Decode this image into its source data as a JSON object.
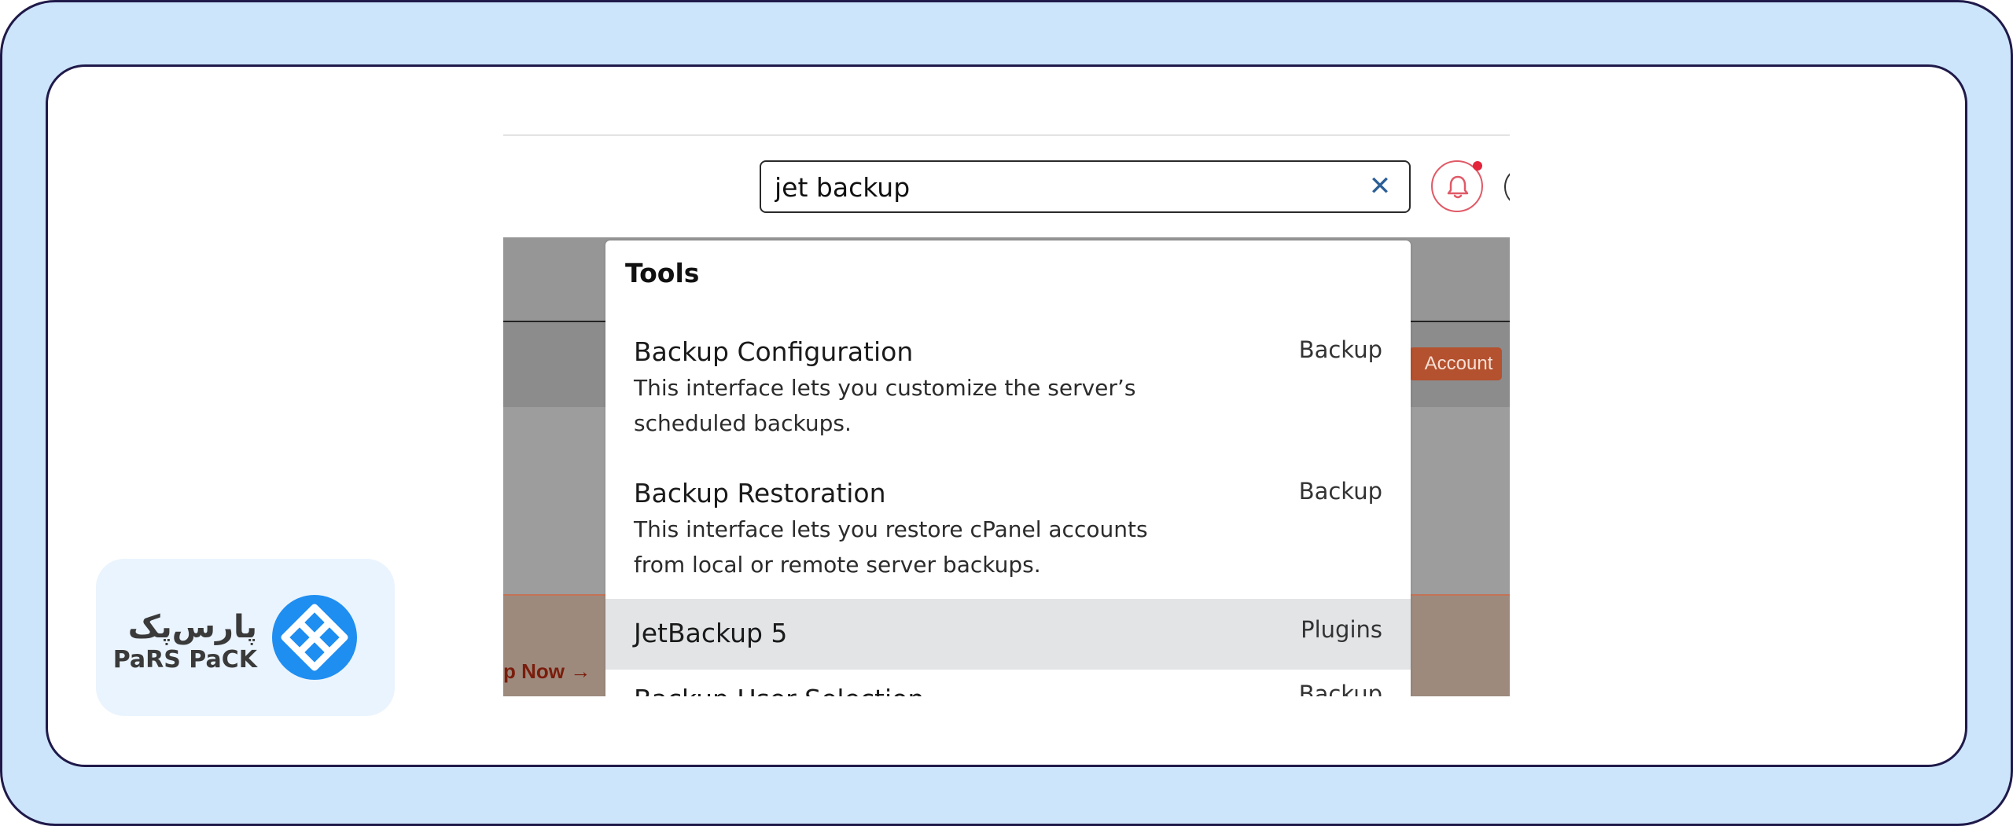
{
  "search": {
    "value": "jet backup",
    "clear_glyph": "✕"
  },
  "page_bg": {
    "account_button": "Account",
    "upgrade_link": "p Now →"
  },
  "dropdown": {
    "heading": "Tools",
    "items": [
      {
        "title": "Backup Configuration",
        "category": "Backup",
        "desc_line1": "This interface lets you customize the server’s",
        "desc_line2": "scheduled backups."
      },
      {
        "title": "Backup Restoration",
        "category": "Backup",
        "desc_line1": "This interface lets you restore cPanel accounts",
        "desc_line2": "from local or remote server backups."
      },
      {
        "title": "JetBackup 5",
        "category": "Plugins"
      },
      {
        "title": "Backup User Selection",
        "category": "Backup"
      }
    ]
  },
  "logo": {
    "text_fa": "پارس‌پک",
    "text_en": "PaRS PaCK"
  },
  "colors": {
    "frame": "#cde5fb",
    "frame_border": "#1f1a4a",
    "logo_blue": "#1f8ef1",
    "bell": "#e05a67"
  }
}
